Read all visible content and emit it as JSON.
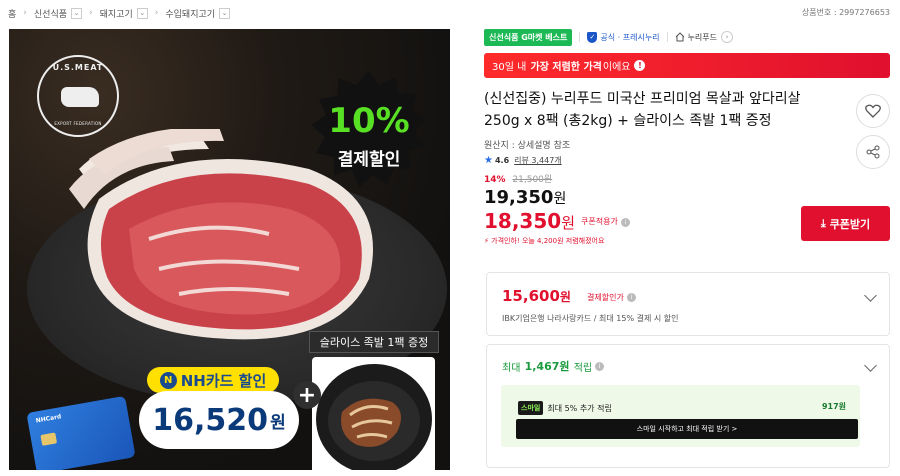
{
  "breadcrumb": {
    "home": "홈",
    "items": [
      "신선식품",
      "돼지고기",
      "수입돼지고기"
    ]
  },
  "product_number": "상품번호 : 2997276653",
  "image": {
    "logo_top": "U.S.MEAT",
    "logo_bottom": "EXPORT FEDERATION",
    "discount_pct": "10%",
    "discount_label": "결제할인",
    "nh_card_label": "NH카드 할인",
    "nh_card_mark": "N",
    "nh_price": "16,520",
    "nh_price_unit": "원",
    "card_logo": "NHCard",
    "gift_label": "슬라이스 족발 1팩 증정",
    "plus": "+"
  },
  "tags": {
    "best": "신선식품 G마켓 베스트",
    "official": "공식 · 프레시누리",
    "store": "누리푸드"
  },
  "lowest_banner": {
    "pre": "30일 내",
    "strong": "가장 저렴한 가격",
    "post": "이에요",
    "icon": "!"
  },
  "product": {
    "title": "(신선집중) 누리푸드 미국산 프리미엄 목살과 앞다리살 250g x 8팩 (총2kg) + 슬라이스 족발 1팩 증정",
    "origin": "원산지 : 상세설명 참조",
    "rating": "4.6",
    "reviews": "리뷰 3,447개"
  },
  "price": {
    "discount_pct": "14%",
    "original": "21,500원",
    "sale": "19,350",
    "sale_unit": "원",
    "coupon_price": "18,350",
    "coupon_unit": "원",
    "coupon_label": "쿠폰적용가",
    "coupon_button": "쿠폰받기",
    "price_info": "가격인하! 오늘 4,200원 저렴해졌어요"
  },
  "card_discount": {
    "value": "15,600",
    "unit": "원",
    "label": "결제할인가",
    "sub": "IBK기업은행 나라사랑카드 / 최대 15% 결제 시 할인"
  },
  "points": {
    "pre": "최대",
    "value": "1,467원",
    "post": "적립",
    "smile_badge": "스마일",
    "smile_text": "최대 5% 추가 적립",
    "smile_amount": "917원",
    "smile_button": "스마일 시작하고 최대 적립 받기 >"
  },
  "colors": {
    "accent_red": "#e0102e",
    "best_green": "#1db954",
    "official_blue": "#1a56c8",
    "points_green": "#1a9b3d"
  }
}
